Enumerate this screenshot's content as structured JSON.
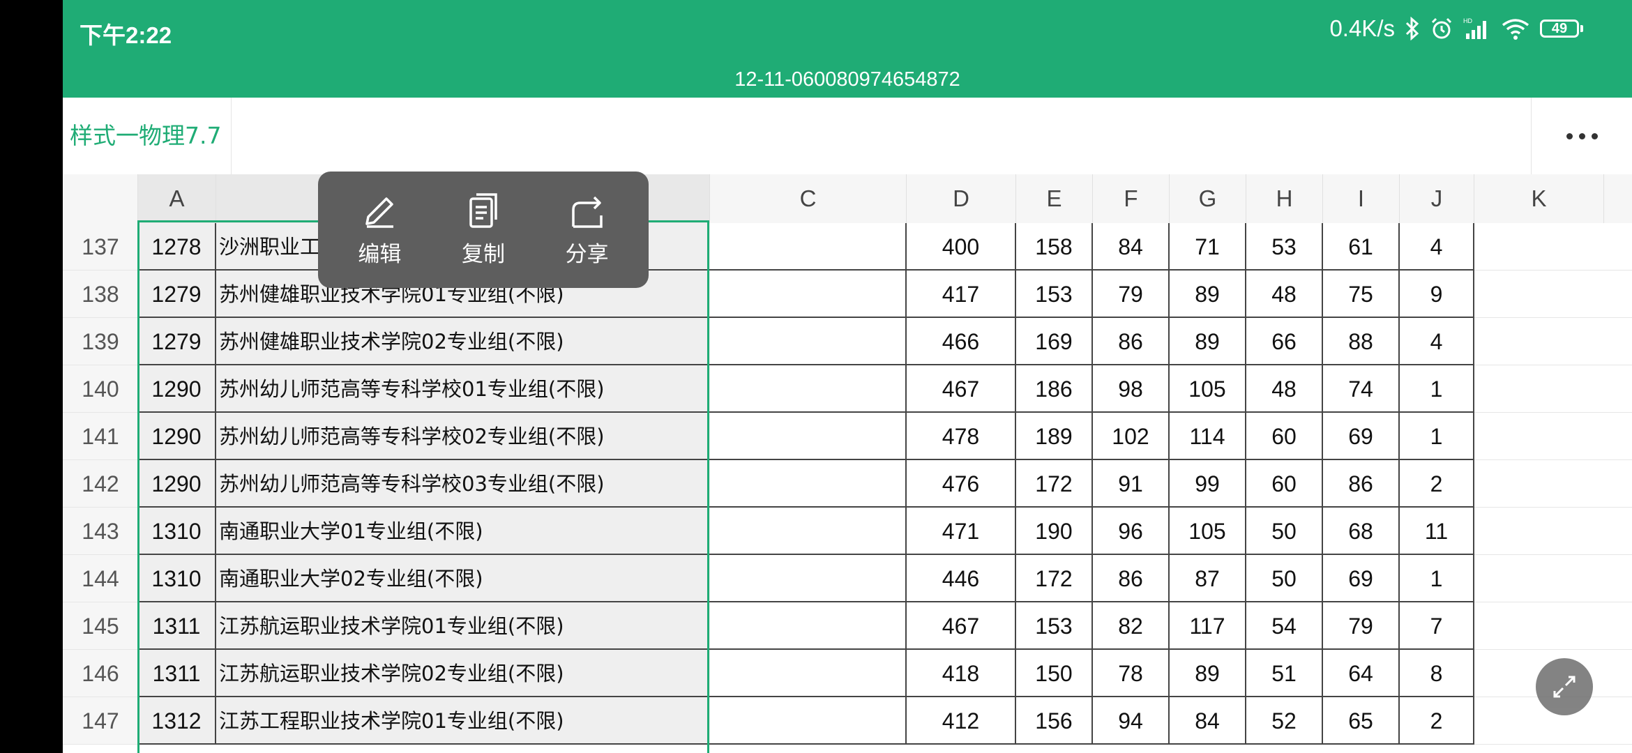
{
  "status": {
    "time": "下午2:22",
    "speed": "0.4K/s",
    "battery": "49"
  },
  "file_name": "12-11-060080974654872",
  "sheet_tab": "样式一物理7.7",
  "columns": [
    "A",
    "C",
    "D",
    "E",
    "F",
    "G",
    "H",
    "I",
    "J",
    "K"
  ],
  "rows": [
    {
      "n": "137",
      "a": "1278",
      "b": "沙洲职业工",
      "d": "400",
      "e": "158",
      "f": "84",
      "g": "71",
      "h": "53",
      "i": "61",
      "j": "4"
    },
    {
      "n": "138",
      "a": "1279",
      "b": "苏州健雄职业技术学院01专业组(不限)",
      "d": "417",
      "e": "153",
      "f": "79",
      "g": "89",
      "h": "48",
      "i": "75",
      "j": "9"
    },
    {
      "n": "139",
      "a": "1279",
      "b": "苏州健雄职业技术学院02专业组(不限)",
      "d": "466",
      "e": "169",
      "f": "86",
      "g": "89",
      "h": "66",
      "i": "88",
      "j": "4"
    },
    {
      "n": "140",
      "a": "1290",
      "b": "苏州幼儿师范高等专科学校01专业组(不限)",
      "d": "467",
      "e": "186",
      "f": "98",
      "g": "105",
      "h": "48",
      "i": "74",
      "j": "1"
    },
    {
      "n": "141",
      "a": "1290",
      "b": "苏州幼儿师范高等专科学校02专业组(不限)",
      "d": "478",
      "e": "189",
      "f": "102",
      "g": "114",
      "h": "60",
      "i": "69",
      "j": "1"
    },
    {
      "n": "142",
      "a": "1290",
      "b": "苏州幼儿师范高等专科学校03专业组(不限)",
      "d": "476",
      "e": "172",
      "f": "91",
      "g": "99",
      "h": "60",
      "i": "86",
      "j": "2"
    },
    {
      "n": "143",
      "a": "1310",
      "b": "南通职业大学01专业组(不限)",
      "d": "471",
      "e": "190",
      "f": "96",
      "g": "105",
      "h": "50",
      "i": "68",
      "j": "11"
    },
    {
      "n": "144",
      "a": "1310",
      "b": "南通职业大学02专业组(不限)",
      "d": "446",
      "e": "172",
      "f": "86",
      "g": "87",
      "h": "50",
      "i": "69",
      "j": "1"
    },
    {
      "n": "145",
      "a": "1311",
      "b": "江苏航运职业技术学院01专业组(不限)",
      "d": "467",
      "e": "153",
      "f": "82",
      "g": "117",
      "h": "54",
      "i": "79",
      "j": "7"
    },
    {
      "n": "146",
      "a": "1311",
      "b": "江苏航运职业技术学院02专业组(不限)",
      "d": "418",
      "e": "150",
      "f": "78",
      "g": "89",
      "h": "51",
      "i": "64",
      "j": "8"
    },
    {
      "n": "147",
      "a": "1312",
      "b": "江苏工程职业技术学院01专业组(不限)",
      "d": "412",
      "e": "156",
      "f": "94",
      "g": "84",
      "h": "52",
      "i": "65",
      "j": "2"
    }
  ],
  "popup": {
    "edit": "编辑",
    "copy": "复制",
    "share": "分享"
  },
  "colors": {
    "accent": "#1fac75"
  }
}
